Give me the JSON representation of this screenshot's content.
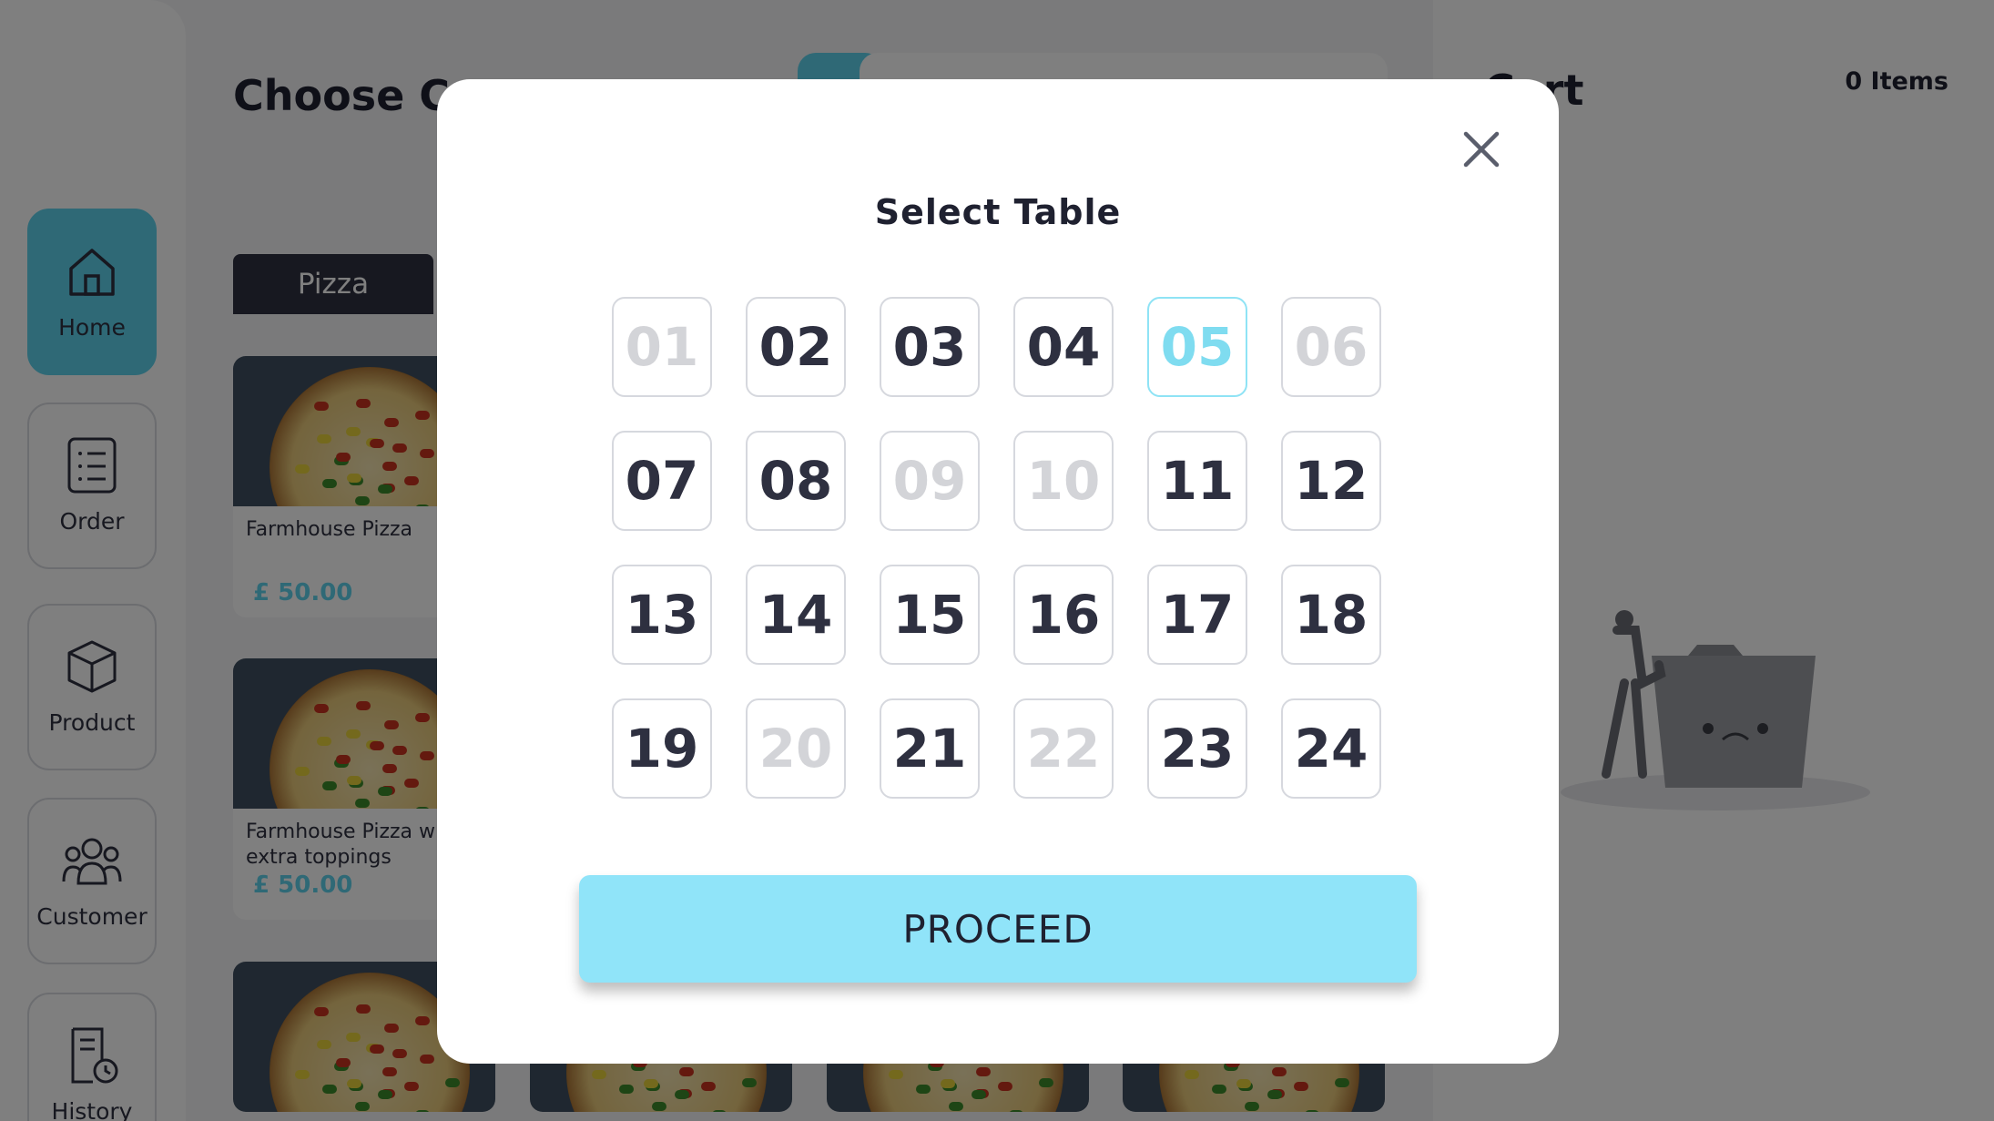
{
  "sidebar": {
    "items": [
      {
        "label": "Home",
        "icon": "home-icon",
        "active": true
      },
      {
        "label": "Order",
        "icon": "order-list-icon",
        "active": false
      },
      {
        "label": "Product",
        "icon": "box-icon",
        "active": false
      },
      {
        "label": "Customer",
        "icon": "users-icon",
        "active": false
      },
      {
        "label": "History",
        "icon": "history-icon",
        "active": false
      }
    ]
  },
  "main": {
    "title": "Choose Category",
    "category_tab": "Pizza",
    "cards": [
      {
        "name": "Farmhouse Pizza",
        "price": "£ 50.00"
      },
      {
        "name": "Farmhouse Pizza with extra toppings",
        "price": "£ 50.00"
      }
    ]
  },
  "cart": {
    "title": "Cart",
    "count": "0 Items"
  },
  "modal": {
    "title": "Select Table",
    "proceed_label": "PROCEED",
    "selected_table": "05",
    "tables": [
      {
        "number": "01",
        "available": false
      },
      {
        "number": "02",
        "available": true
      },
      {
        "number": "03",
        "available": true
      },
      {
        "number": "04",
        "available": true
      },
      {
        "number": "05",
        "available": true
      },
      {
        "number": "06",
        "available": false
      },
      {
        "number": "07",
        "available": true
      },
      {
        "number": "08",
        "available": true
      },
      {
        "number": "09",
        "available": false
      },
      {
        "number": "10",
        "available": false
      },
      {
        "number": "11",
        "available": true
      },
      {
        "number": "12",
        "available": true
      },
      {
        "number": "13",
        "available": true
      },
      {
        "number": "14",
        "available": true
      },
      {
        "number": "15",
        "available": true
      },
      {
        "number": "16",
        "available": true
      },
      {
        "number": "17",
        "available": true
      },
      {
        "number": "18",
        "available": true
      },
      {
        "number": "19",
        "available": true
      },
      {
        "number": "20",
        "available": false
      },
      {
        "number": "21",
        "available": true
      },
      {
        "number": "22",
        "available": false
      },
      {
        "number": "23",
        "available": true
      },
      {
        "number": "24",
        "available": true
      }
    ]
  },
  "colors": {
    "accent": "#5ed2ec",
    "proceed_bg": "#90e4f9",
    "text_dark": "#2e3040",
    "disabled_text": "#d3d4d8"
  }
}
